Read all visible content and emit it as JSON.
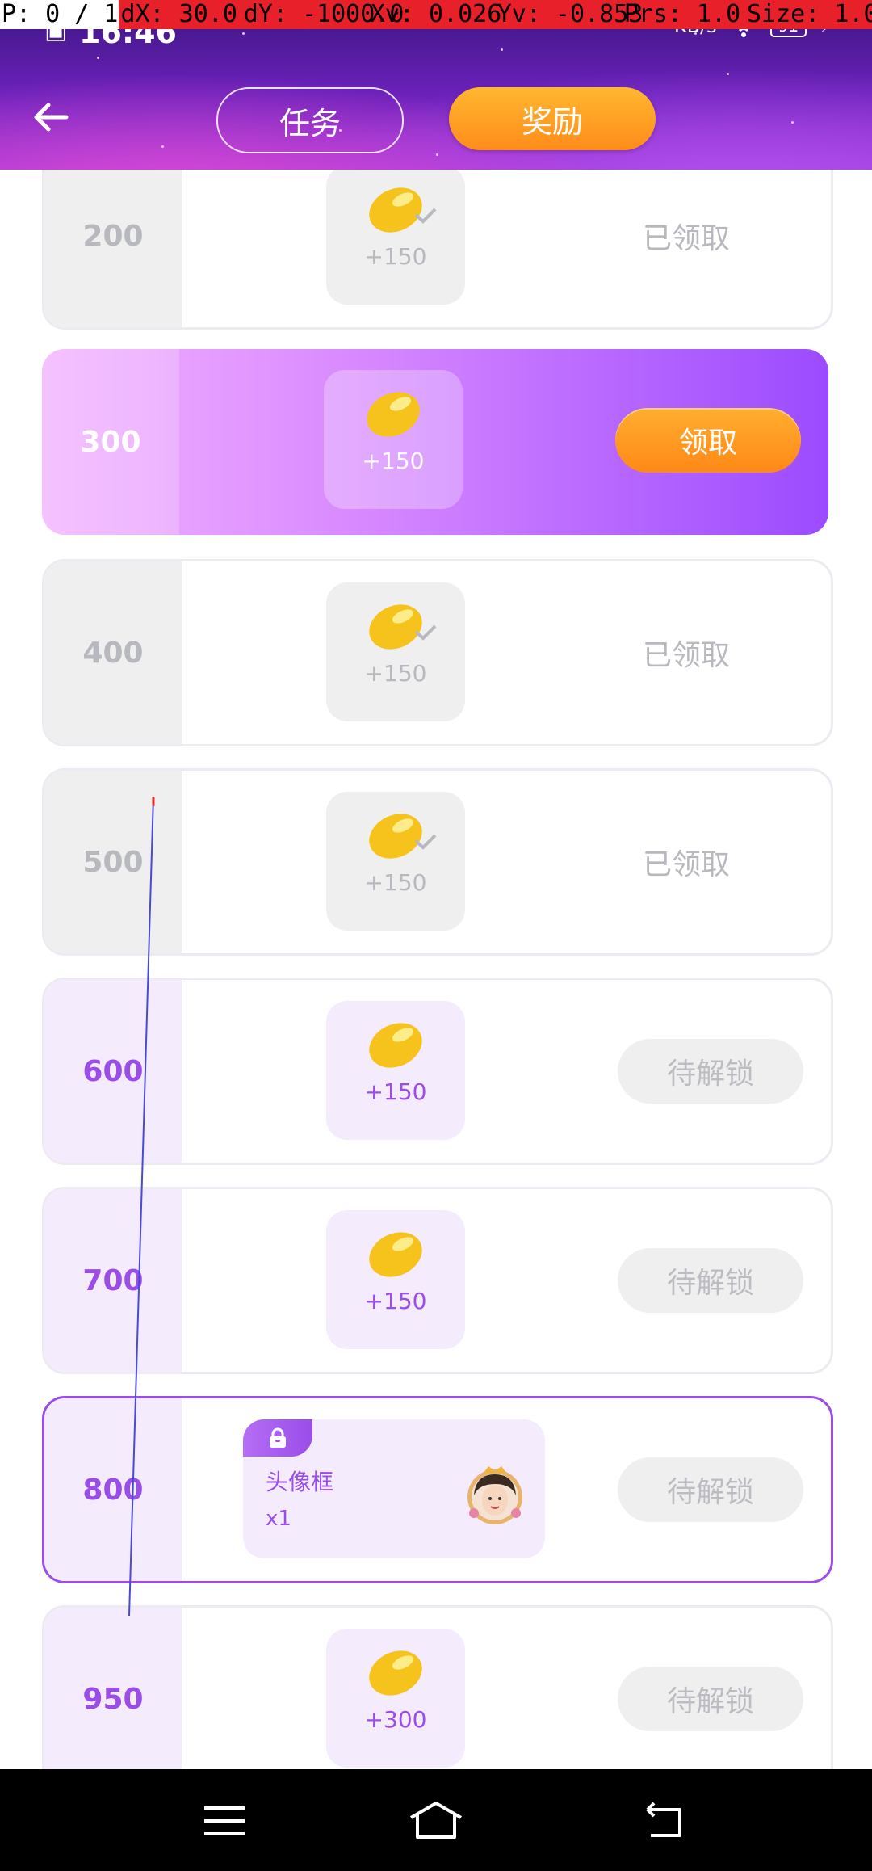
{
  "debug_overlay": {
    "pointer": "P: 0 / 1",
    "dx": "dX: 30.0",
    "dy": "dY: -1000.0",
    "xv": "Xv: 0.026",
    "yv": "Yv: -0.853",
    "prs": "Prs: 1.0",
    "size": "Size: 1.0"
  },
  "status_bar": {
    "time": "16:46",
    "net_speed_unit": "KB/s",
    "battery": "91"
  },
  "header": {
    "tabs": [
      {
        "label": "任务",
        "selected": false
      },
      {
        "label": "奖励",
        "selected": true
      }
    ]
  },
  "colors": {
    "accent_purple": "#9a4de8",
    "claim_orange": "#ff8c1a",
    "muted_gray": "#b8b8bf"
  },
  "rewards": [
    {
      "threshold": "200",
      "amount": "+150",
      "state": "claimed",
      "action": "已领取"
    },
    {
      "threshold": "300",
      "amount": "+150",
      "state": "active",
      "action": "领取"
    },
    {
      "threshold": "400",
      "amount": "+150",
      "state": "claimed",
      "action": "已领取"
    },
    {
      "threshold": "500",
      "amount": "+150",
      "state": "claimed",
      "action": "已领取"
    },
    {
      "threshold": "600",
      "amount": "+150",
      "state": "locked",
      "action": "待解锁"
    },
    {
      "threshold": "700",
      "amount": "+150",
      "state": "locked",
      "action": "待解锁"
    },
    {
      "threshold": "800",
      "item_name": "头像框",
      "item_count": "x1",
      "state": "locked",
      "action": "待解锁"
    },
    {
      "threshold": "950",
      "amount": "+300",
      "state": "locked",
      "action": "待解锁"
    }
  ]
}
